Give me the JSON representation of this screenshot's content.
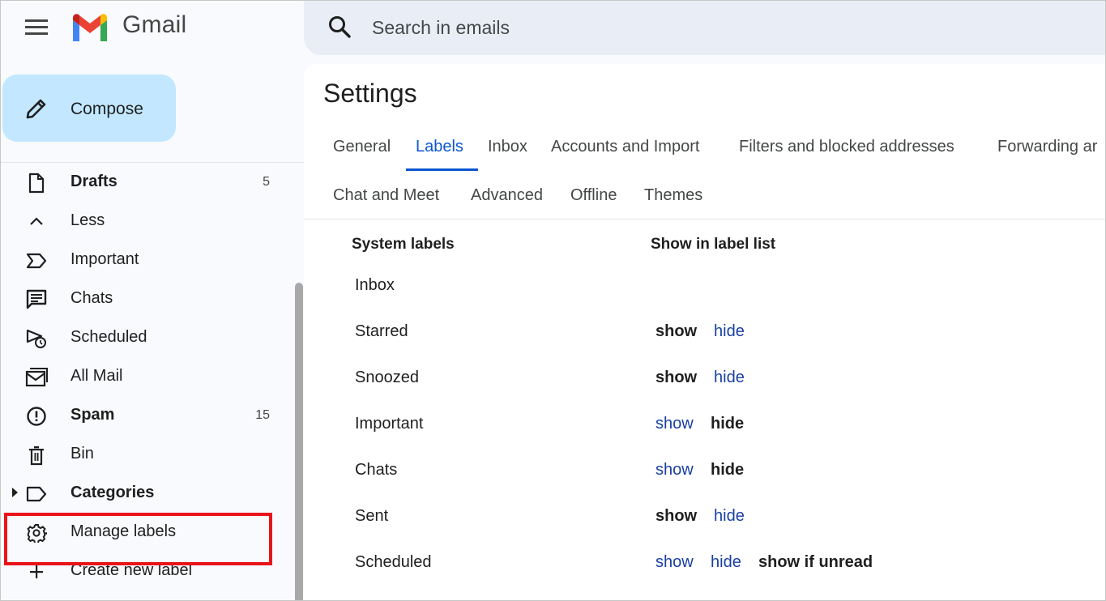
{
  "app": {
    "name": "Gmail"
  },
  "compose": {
    "label": "Compose"
  },
  "search": {
    "placeholder": "Search in emails"
  },
  "sidebar": {
    "items": [
      {
        "label": "Drafts",
        "count": "5",
        "bold": true,
        "icon": "draft-icon"
      },
      {
        "label": "Less",
        "count": "",
        "bold": false,
        "icon": "chevron-up-icon"
      },
      {
        "label": "Important",
        "count": "",
        "bold": false,
        "icon": "important-icon"
      },
      {
        "label": "Chats",
        "count": "",
        "bold": false,
        "icon": "chat-icon"
      },
      {
        "label": "Scheduled",
        "count": "",
        "bold": false,
        "icon": "scheduled-icon"
      },
      {
        "label": "All Mail",
        "count": "",
        "bold": false,
        "icon": "all-mail-icon"
      },
      {
        "label": "Spam",
        "count": "15",
        "bold": true,
        "icon": "spam-icon"
      },
      {
        "label": "Bin",
        "count": "",
        "bold": false,
        "icon": "bin-icon"
      },
      {
        "label": "Categories",
        "count": "",
        "bold": true,
        "icon": "label-icon"
      },
      {
        "label": "Manage labels",
        "count": "",
        "bold": false,
        "icon": "gear-icon"
      },
      {
        "label": "Create new label",
        "count": "",
        "bold": false,
        "icon": "plus-icon"
      }
    ]
  },
  "settings": {
    "title": "Settings",
    "tabs_row1": [
      "General",
      "Labels",
      "Inbox",
      "Accounts and Import",
      "Filters and blocked addresses",
      "Forwarding ar"
    ],
    "tabs_row2": [
      "Chat and Meet",
      "Advanced",
      "Offline",
      "Themes"
    ],
    "active_tab": "Labels",
    "columns": {
      "system_labels": "System labels",
      "show_in_label_list": "Show in label list"
    },
    "options": {
      "show": "show",
      "hide": "hide",
      "show_if_unread": "show if unread"
    },
    "labels": [
      {
        "name": "Inbox",
        "state": "none"
      },
      {
        "name": "Starred",
        "state": "show"
      },
      {
        "name": "Snoozed",
        "state": "show"
      },
      {
        "name": "Important",
        "state": "hide"
      },
      {
        "name": "Chats",
        "state": "hide"
      },
      {
        "name": "Sent",
        "state": "show"
      },
      {
        "name": "Scheduled",
        "state": "show if unread"
      }
    ]
  },
  "colors": {
    "accent": "#0b57d0",
    "compose_bg": "#c2e7ff",
    "link": "#1a3fa3",
    "highlight": "#e8141a"
  }
}
